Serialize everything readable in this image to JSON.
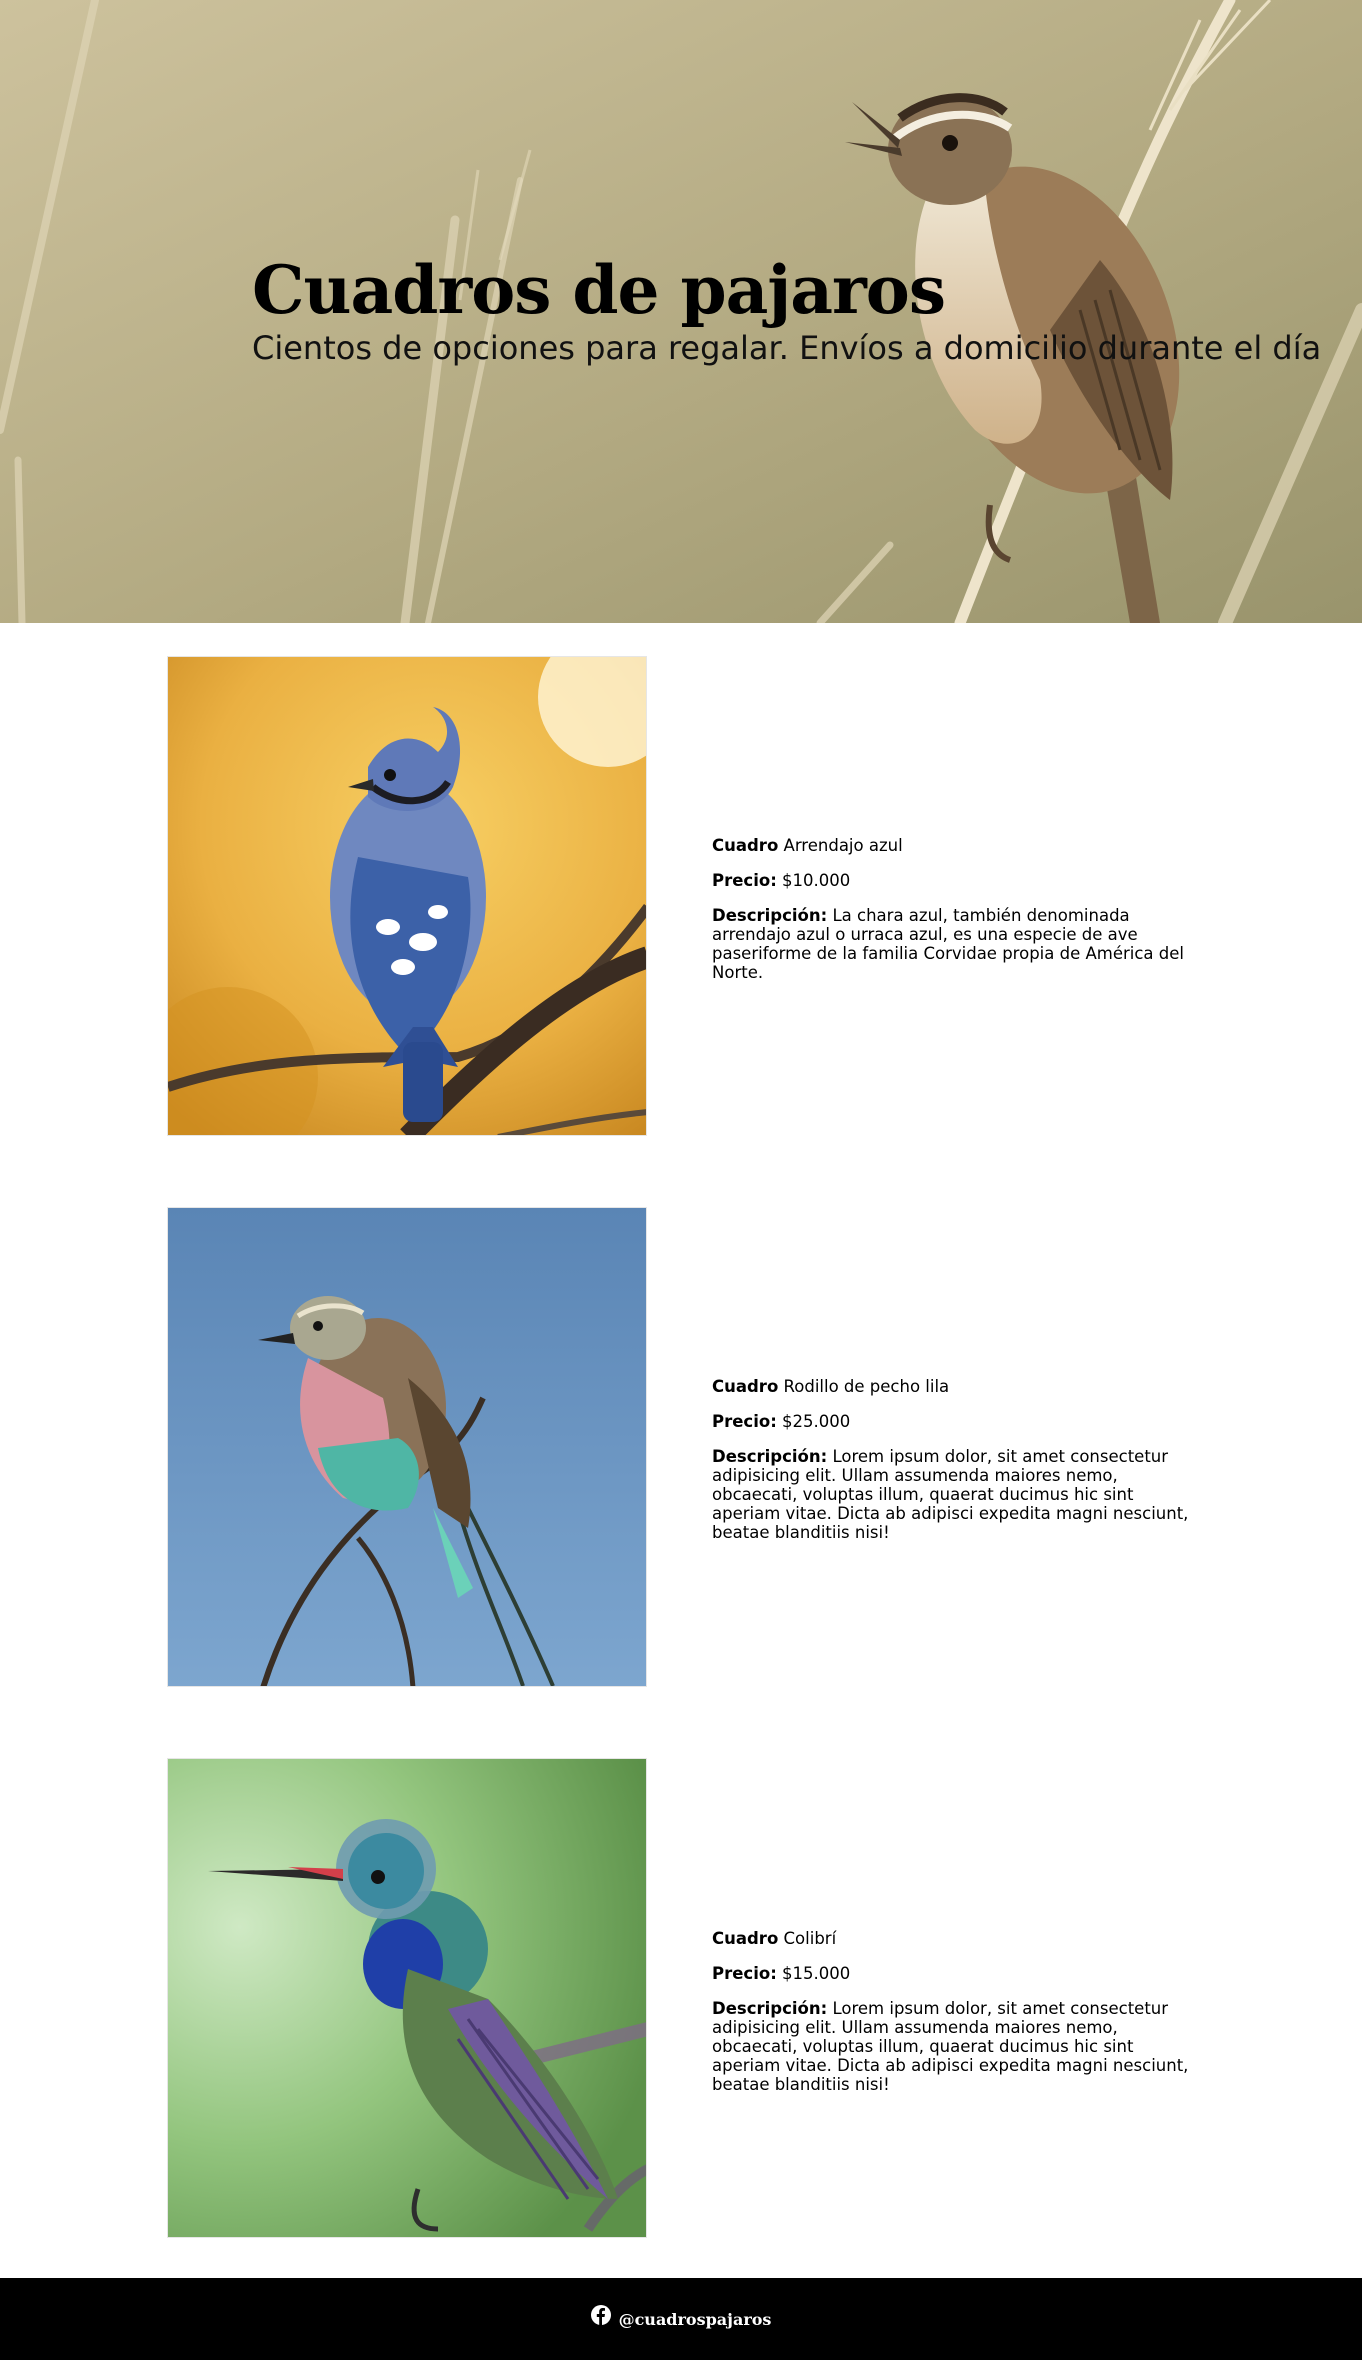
{
  "hero": {
    "title": "Cuadros de pajaros",
    "subtitle": "Cientos de opciones para regalar. Envíos a domicilio durante el día",
    "background_icon": "bird-photo"
  },
  "products": [
    {
      "label_cuadro": "Cuadro",
      "name": "Arrendajo azul",
      "label_precio": "Precio:",
      "price": "$10.000",
      "label_descripcion": "Descripción:",
      "description": "La chara azul, también denominada arrendajo azul o urraca azul, es una especie de ave paseriforme de la familia Corvidae propia de América del Norte.",
      "image_icon": "blue-jay-photo",
      "accent": "#3d6db5"
    },
    {
      "label_cuadro": "Cuadro",
      "name": "Rodillo de pecho lila",
      "label_precio": "Precio:",
      "price": "$25.000",
      "label_descripcion": "Descripción:",
      "description": "Lorem ipsum dolor, sit amet consectetur adipisicing elit. Ullam assumenda maiores nemo, obcaecati, voluptas illum, quaerat ducimus hic sint aperiam vitae. Dicta ab adipisci expedita magni nesciunt, beatae blanditiis nisi!",
      "image_icon": "lilac-breasted-roller-photo",
      "accent": "#6a94c0"
    },
    {
      "label_cuadro": "Cuadro",
      "name": "Colibrí",
      "label_precio": "Precio:",
      "price": "$15.000",
      "label_descripcion": "Descripción:",
      "description": "Lorem ipsum dolor, sit amet consectetur adipisicing elit. Ullam assumenda maiores nemo, obcaecati, voluptas illum, quaerat ducimus hic sint aperiam vitae. Dicta ab adipisci expedita magni nesciunt, beatae blanditiis nisi!",
      "image_icon": "hummingbird-photo",
      "accent": "#7cb86a"
    }
  ],
  "footer": {
    "social_icon": "facebook-icon",
    "handle": "@cuadrospajaros",
    "background": "#000000"
  }
}
